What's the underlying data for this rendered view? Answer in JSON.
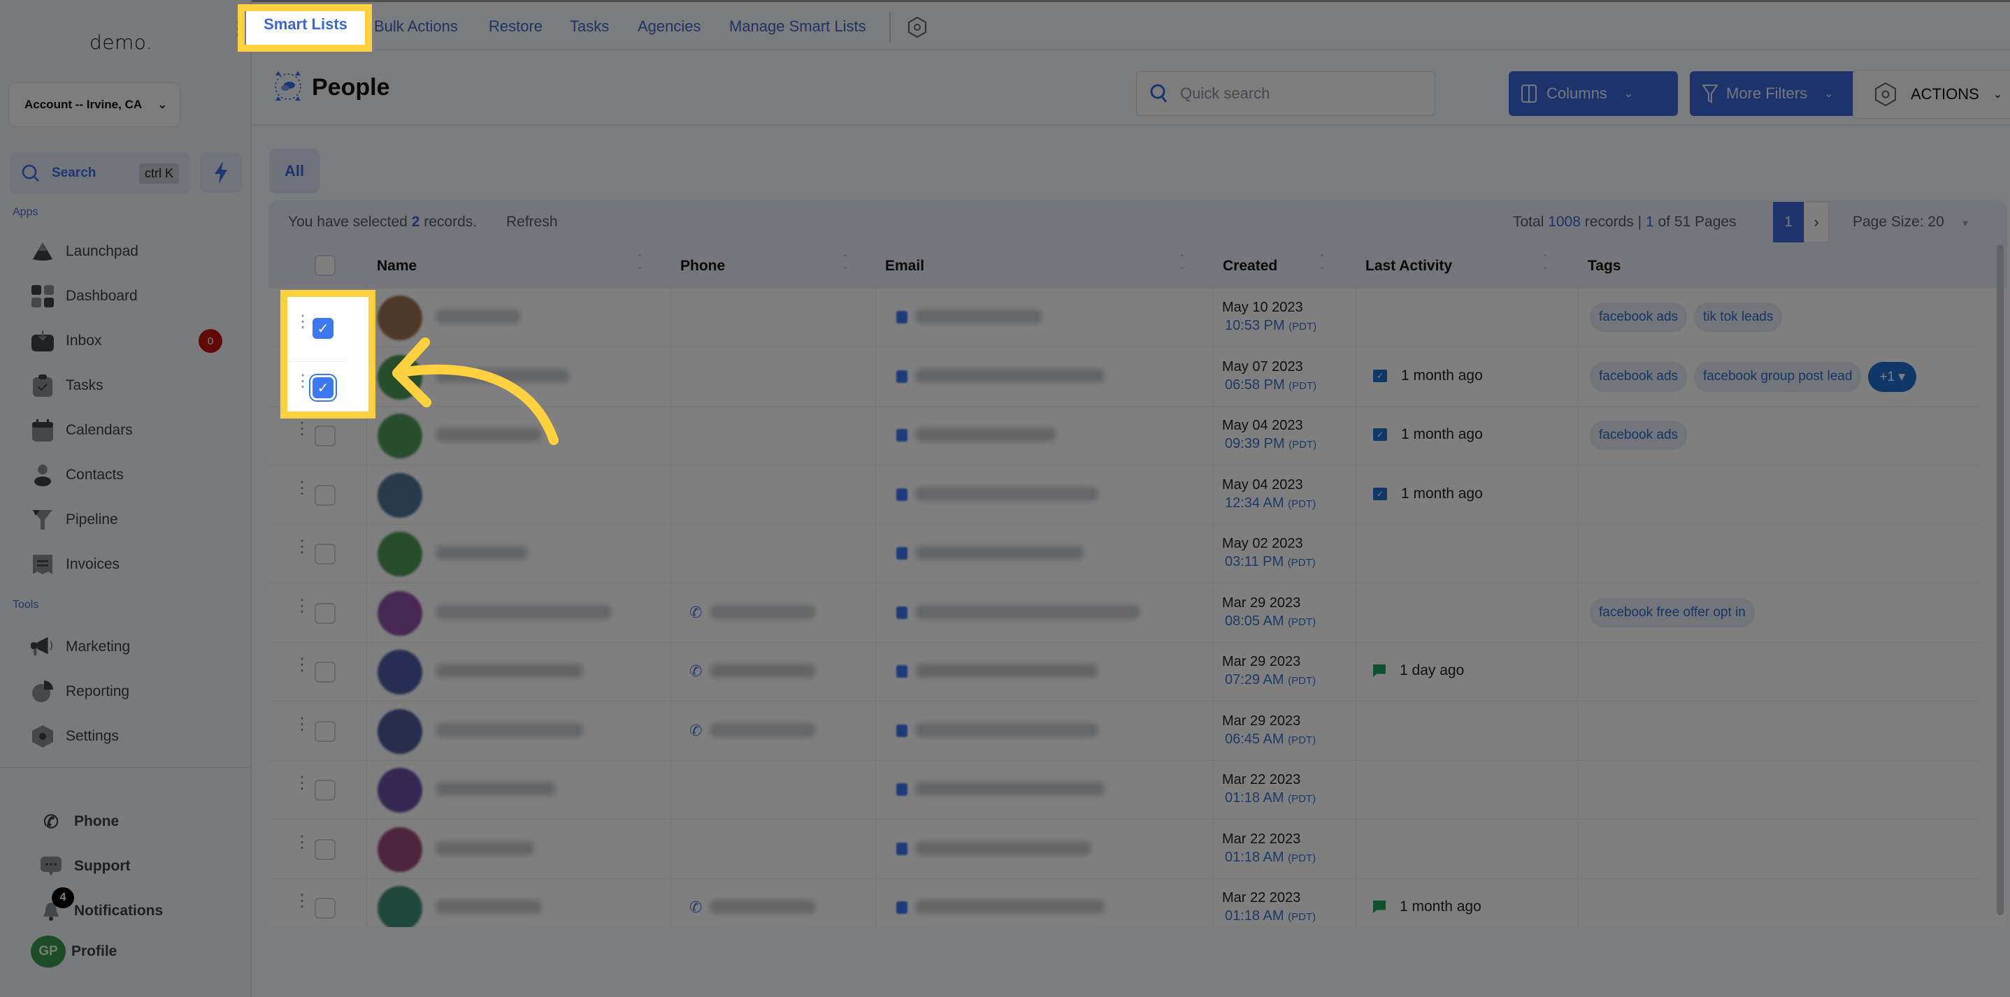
{
  "sidebar": {
    "logo": "demo.",
    "account": "Account -- Irvine, CA",
    "search_label": "Search",
    "search_shortcut": "ctrl K",
    "apps_label": "Apps",
    "apps": [
      {
        "label": "Launchpad",
        "icon": "launchpad-icon"
      },
      {
        "label": "Dashboard",
        "icon": "dashboard-icon"
      },
      {
        "label": "Inbox",
        "icon": "inbox-icon",
        "badge": "0"
      },
      {
        "label": "Tasks",
        "icon": "tasks-icon"
      },
      {
        "label": "Calendars",
        "icon": "calendar-icon"
      },
      {
        "label": "Contacts",
        "icon": "contacts-icon"
      },
      {
        "label": "Pipeline",
        "icon": "pipeline-icon"
      },
      {
        "label": "Invoices",
        "icon": "invoices-icon"
      }
    ],
    "tools_label": "Tools",
    "tools": [
      {
        "label": "Marketing",
        "icon": "megaphone-icon"
      },
      {
        "label": "Reporting",
        "icon": "pie-chart-icon"
      },
      {
        "label": "Settings",
        "icon": "settings-icon"
      }
    ],
    "bottom": {
      "phone": "Phone",
      "support": "Support",
      "notifications": "Notifications",
      "notifications_count": "4",
      "profile": "Profile",
      "profile_initials": "GP"
    }
  },
  "topnav": {
    "tabs": [
      "Smart Lists",
      "Bulk Actions",
      "Restore",
      "Tasks",
      "Agencies",
      "Manage Smart Lists"
    ],
    "active_tab": "Smart Lists"
  },
  "header": {
    "title": "People",
    "search_placeholder": "Quick search",
    "columns_btn": "Columns",
    "filters_btn": "More Filters",
    "actions_btn": "ACTIONS"
  },
  "tabs": {
    "all": "All"
  },
  "toolbar": {
    "selected_prefix": "You have selected",
    "selected_count": "2",
    "selected_suffix": "records.",
    "refresh": "Refresh",
    "total_prefix": "Total",
    "total_count": "1008",
    "total_mid": "records |",
    "current_page": "1",
    "pages_suffix": "of 51 Pages",
    "page_btn": "1",
    "next": "›",
    "page_size": "Page Size: 20"
  },
  "table": {
    "columns": [
      "Name",
      "Phone",
      "Email",
      "Created",
      "Last Activity",
      "Tags"
    ],
    "rows": [
      {
        "checked": true,
        "avatar": "#a0714c",
        "has_phone": false,
        "date": "May 10 2023",
        "time": "10:53 PM",
        "tz": "(PDT)",
        "activity": "",
        "activity_type": "",
        "tags": [
          "facebook ads",
          "tik tok leads"
        ],
        "more": ""
      },
      {
        "checked": true,
        "avatar": "#4f9b57",
        "has_phone": false,
        "date": "May 07 2023",
        "time": "06:58 PM",
        "tz": "(PDT)",
        "activity": "1 month ago",
        "activity_type": "email",
        "tags": [
          "facebook ads",
          "facebook group post lead"
        ],
        "more": "+1 ▾"
      },
      {
        "checked": false,
        "avatar": "#4f9b57",
        "has_phone": false,
        "date": "May 04 2023",
        "time": "09:39 PM",
        "tz": "(PDT)",
        "activity": "1 month ago",
        "activity_type": "email",
        "tags": [
          "facebook ads"
        ],
        "more": ""
      },
      {
        "checked": false,
        "avatar": "#4e7396",
        "has_phone": false,
        "date": "May 04 2023",
        "time": "12:34 AM",
        "tz": "(PDT)",
        "activity": "1 month ago",
        "activity_type": "email",
        "tags": [],
        "more": ""
      },
      {
        "checked": false,
        "avatar": "#4f9b57",
        "has_phone": false,
        "date": "May 02 2023",
        "time": "03:11 PM",
        "tz": "(PDT)",
        "activity": "",
        "activity_type": "",
        "tags": [],
        "more": ""
      },
      {
        "checked": false,
        "avatar": "#8e4fa8",
        "has_phone": true,
        "date": "Mar 29 2023",
        "time": "08:05 AM",
        "tz": "(PDT)",
        "activity": "",
        "activity_type": "",
        "tags": [
          "facebook free offer opt in"
        ],
        "more": ""
      },
      {
        "checked": false,
        "avatar": "#4f5ca8",
        "has_phone": true,
        "date": "Mar 29 2023",
        "time": "07:29 AM",
        "tz": "(PDT)",
        "activity": "1 day ago",
        "activity_type": "sms",
        "tags": [],
        "more": ""
      },
      {
        "checked": false,
        "avatar": "#4c5a9a",
        "has_phone": true,
        "date": "Mar 29 2023",
        "time": "06:45 AM",
        "tz": "(PDT)",
        "activity": "",
        "activity_type": "",
        "tags": [],
        "more": ""
      },
      {
        "checked": false,
        "avatar": "#6a52a8",
        "has_phone": false,
        "date": "Mar 22 2023",
        "time": "01:18 AM",
        "tz": "(PDT)",
        "activity": "",
        "activity_type": "",
        "tags": [],
        "more": ""
      },
      {
        "checked": false,
        "avatar": "#9a4a78",
        "has_phone": false,
        "date": "Mar 22 2023",
        "time": "01:18 AM",
        "tz": "(PDT)",
        "activity": "",
        "activity_type": "",
        "tags": [],
        "more": ""
      },
      {
        "checked": false,
        "avatar": "#3f8f78",
        "has_phone": true,
        "date": "Mar 22 2023",
        "time": "01:18 AM",
        "tz": "(PDT)",
        "activity": "1 month ago",
        "activity_type": "sms",
        "tags": [],
        "more": ""
      }
    ]
  },
  "colors": {
    "accent": "#3a67d8",
    "highlight": "#ffd13f",
    "badge_red": "#c41111"
  }
}
